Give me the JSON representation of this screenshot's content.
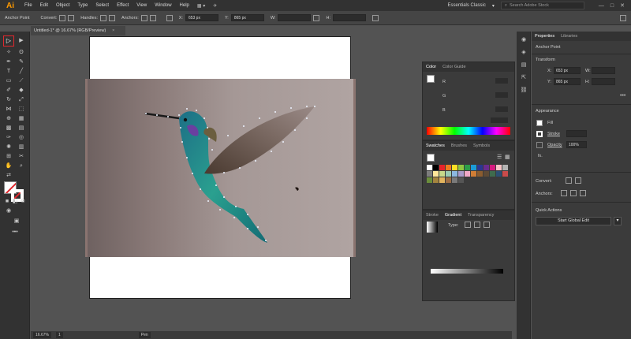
{
  "app": {
    "logo": "Ai"
  },
  "menubar": {
    "items": [
      "File",
      "Edit",
      "Object",
      "Type",
      "Select",
      "Effect",
      "View",
      "Window",
      "Help"
    ],
    "workspace": "Essentials Classic",
    "search_placeholder": "Search Adobe Stock"
  },
  "control": {
    "label": "Anchor Point",
    "convert": "Convert:",
    "handles": "Handles:",
    "anchors": "Anchors:",
    "x_label": "X:",
    "x_value": "653 px",
    "y_label": "Y:",
    "y_value": "865 px",
    "w_label": "W:",
    "h_label": "H:"
  },
  "document": {
    "tab_title": "Untitled-1* @ 16.67% (RGB/Preview)",
    "close": "×"
  },
  "status": {
    "zoom": "16.67%",
    "page": "1",
    "mode": "Pen"
  },
  "color_panel": {
    "tab1": "Color",
    "tab2": "Color Guide",
    "channels": [
      "R",
      "G",
      "B"
    ]
  },
  "swatches_panel": {
    "tabs": [
      "Swatches",
      "Brushes",
      "Symbols"
    ]
  },
  "swatch_colors": [
    "#ffffff",
    "#000000",
    "#e6232a",
    "#ee7b1f",
    "#fde025",
    "#8ec642",
    "#2c9e48",
    "#1b9bd7",
    "#2b3692",
    "#6a2c8e",
    "#d6197e",
    "#f6c3c6",
    "#b3b3b3",
    "#7d7d7d",
    "#ffe69a",
    "#c8d98a",
    "#9bcbb1",
    "#8cb8e0",
    "#a99ac9",
    "#f0a7c6",
    "#d07d35",
    "#8b5c2f",
    "#5d4a36",
    "#3f6b4d",
    "#2c4f73",
    "#c94b4b",
    "#6b8e3c",
    "#a4843e",
    "#e2b45e",
    "#9c6d45",
    "#7a7a7a",
    "#555555"
  ],
  "gradient_panel": {
    "tabs": [
      "Stroke",
      "Gradient",
      "Transparency"
    ],
    "type_label": "Type:"
  },
  "properties": {
    "tabs": [
      "Properties",
      "Libraries"
    ],
    "selection": "Anchor Point",
    "transform": "Transform",
    "x_label": "X:",
    "x_value": "653 px",
    "y_label": "Y:",
    "y_value": "865 px",
    "w_label": "W:",
    "h_label": "H:",
    "appearance": "Appearance",
    "fill": "Fill",
    "stroke": "Stroke",
    "opacity": "Opacity",
    "opacity_value": "100%",
    "fx": "fx.",
    "convert": "Convert:",
    "anchors": "Anchors:",
    "quick_actions": "Quick Actions",
    "global_edit": "Start Global Edit"
  }
}
